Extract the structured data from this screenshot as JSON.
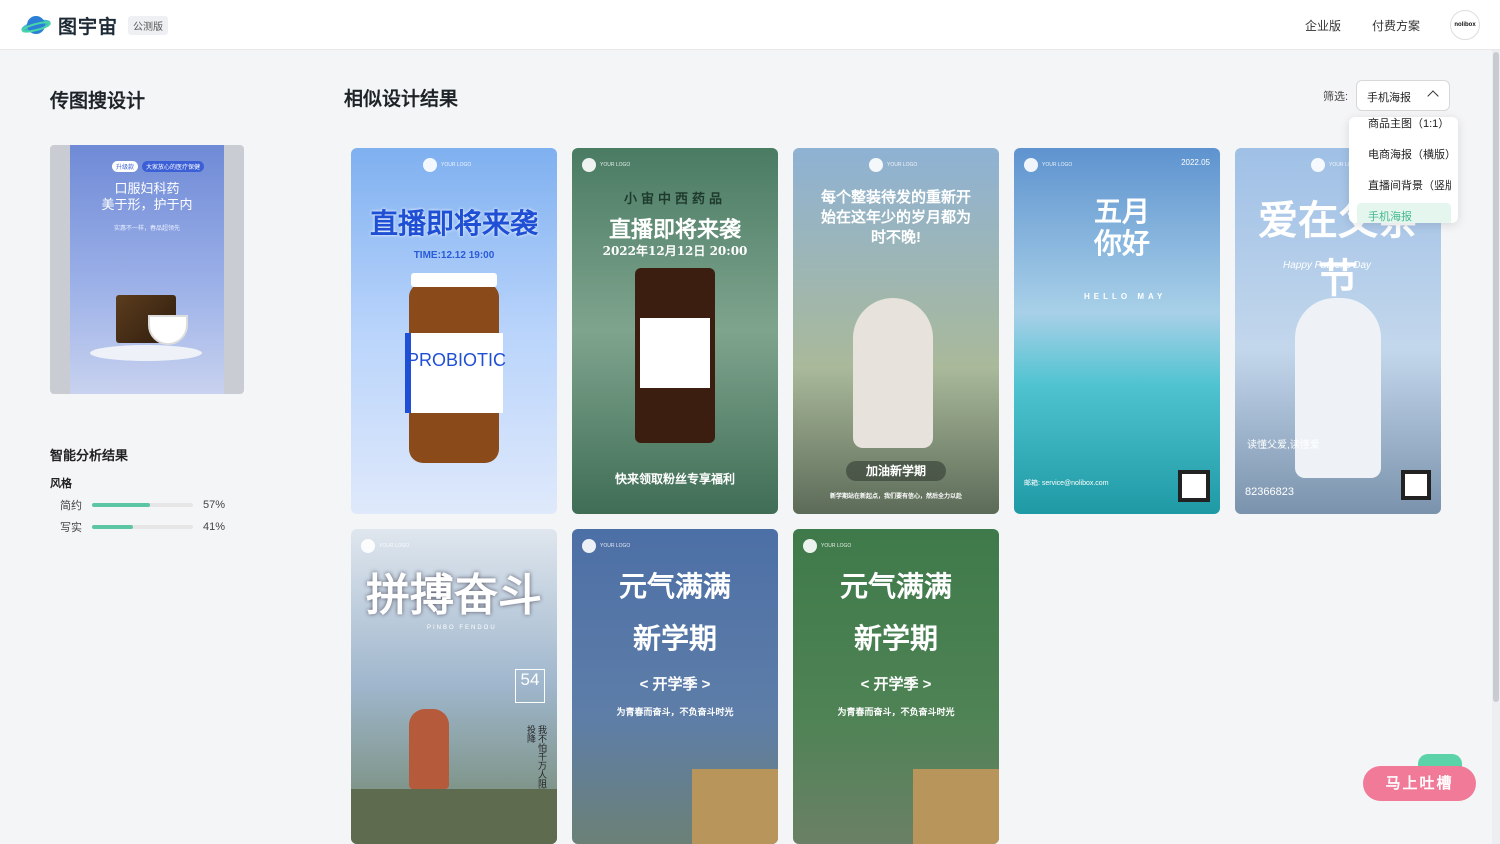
{
  "header": {
    "brand": "图宇宙",
    "beta": "公测版",
    "nav_enterprise": "企业版",
    "nav_pricing": "付费方案",
    "avatar_text": "nolibox"
  },
  "left": {
    "title": "传图搜设计",
    "upload_preview": {
      "badge1": "升级款",
      "badge2": "大家放心的医疗保健",
      "title_line1": "口服妇科药",
      "title_line2": "美于形，护于内",
      "sub": "实惠不一样，春品超领先"
    },
    "analysis_title": "智能分析结果",
    "style_label": "风格",
    "stats": [
      {
        "name": "简约",
        "value": "57%",
        "fraction": 0.57
      },
      {
        "name": "写实",
        "value": "41%",
        "fraction": 0.41
      }
    ]
  },
  "main": {
    "title": "相似设计结果",
    "filter_label": "筛选:",
    "filter_value": "手机海报",
    "dropdown": [
      "商品主图（1:1）",
      "电商海报（横版）",
      "直播间背景（竖版",
      "手机海报"
    ],
    "cards": [
      {
        "logo": "YOUR LOGO",
        "headline": "直播即将来袭",
        "sub": "TIME:12.12 19:00",
        "extra": "PROBIOTIC"
      },
      {
        "logo": "YOUR LOGO",
        "brand": "小宙中西药品",
        "headline": "直播即将来袭",
        "sub": "2022年12月12日 20:00",
        "extra": "快来领取粉丝专享福利"
      },
      {
        "logo": "YOUR LOGO",
        "headline": "每个整装待发的重新开始在这年少的岁月都为时不晚!",
        "sub": "加油新学期",
        "extra": "新学期站在新起点，我们要有信心，然后全力以赴"
      },
      {
        "logo": "YOUR LOGO",
        "date": "2022.05",
        "headline": "五月你好",
        "sub": "HELLO MAY",
        "extra": "邮箱: service@nolibox.com"
      },
      {
        "logo": "YOUR LOGO",
        "headline": "爱在父亲节",
        "sub": "Happy Father's Day",
        "extra": "读懂父爱,读懂爱",
        "phone": "82366823"
      },
      {
        "logo": "YOUR LOGO",
        "headline": "拼搏奋斗",
        "sub": "PINBO FENDOU",
        "num": "54",
        "extra": "我不怕千万人阻挡 只怕自己投降"
      },
      {
        "logo": "YOUR LOGO",
        "headline": "元气满满",
        "headline2": "新学期",
        "sub": "< 开学季 >",
        "extra": "为青春而奋斗，不负奋斗时光"
      },
      {
        "logo": "YOUR LOGO",
        "headline": "元气满满",
        "headline2": "新学期",
        "sub": "< 开学季 >",
        "extra": "为青春而奋斗，不负奋斗时光"
      }
    ]
  },
  "feedback": "马上吐槽",
  "colors": {
    "accent": "#5cc5a3",
    "feedback": "#f07a97"
  }
}
